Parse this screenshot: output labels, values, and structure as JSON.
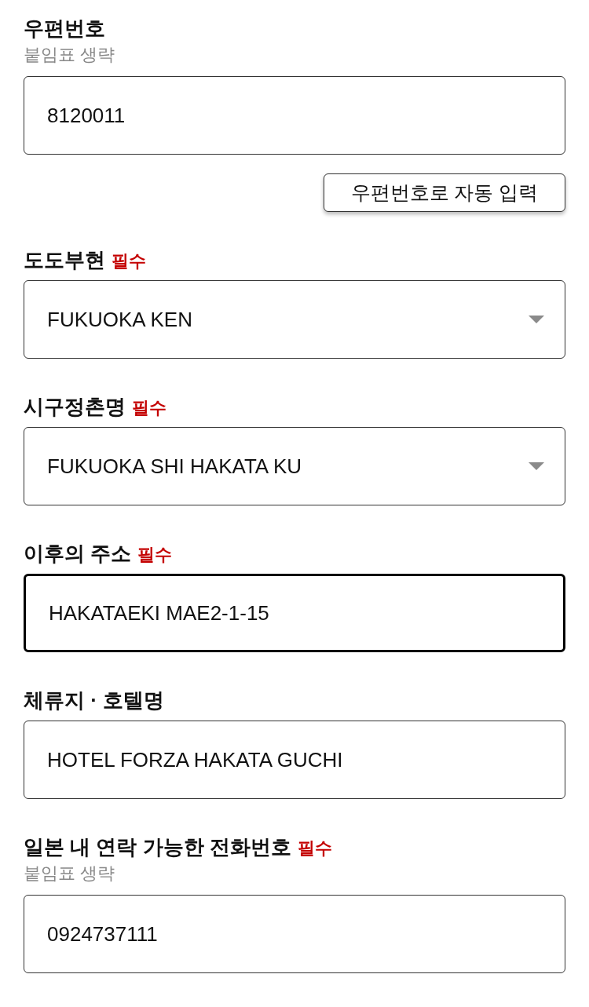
{
  "form": [
    {
      "kind": "text",
      "label": "우편번호",
      "hint": "붙임표 생략",
      "value": "8120011",
      "focused": false
    },
    {
      "kind": "button",
      "label": "우편번호로 자동 입력"
    },
    {
      "kind": "select",
      "label": "도도부현",
      "required_badge": "필수",
      "value": "FUKUOKA KEN",
      "focused": false
    },
    {
      "kind": "select",
      "label": "시구정촌명",
      "required_badge": "필수",
      "value": "FUKUOKA SHI HAKATA KU",
      "focused": false
    },
    {
      "kind": "text",
      "label": "이후의 주소",
      "required_badge": "필수",
      "value": "HAKATAEKI MAE2-1-15",
      "focused": true
    },
    {
      "kind": "text",
      "label": "체류지 · 호텔명",
      "value": "HOTEL FORZA HAKATA GUCHI",
      "focused": false
    },
    {
      "kind": "text",
      "label": "일본 내 연락 가능한 전화번호",
      "required_badge": "필수",
      "hint": "붙임표 생략",
      "value": "0924737111",
      "focused": false
    }
  ]
}
